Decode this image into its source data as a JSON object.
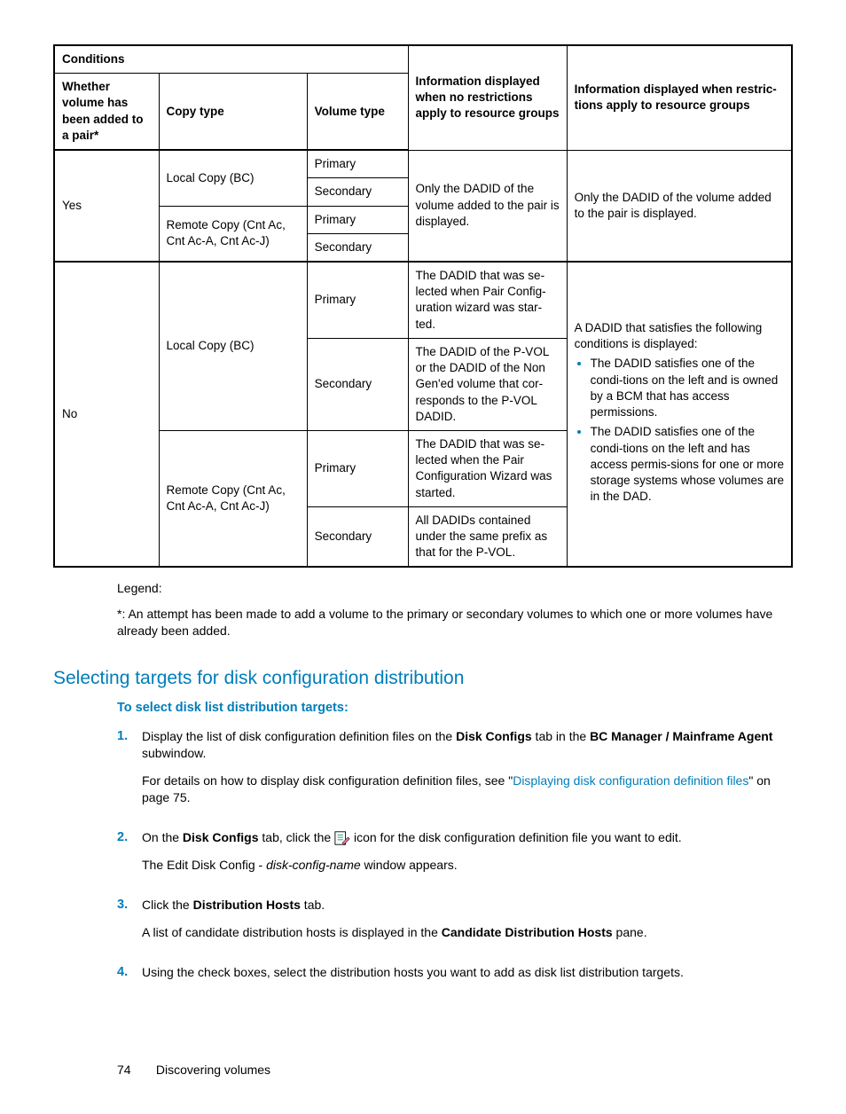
{
  "table": {
    "headers": {
      "conditions": "Conditions",
      "whether": "Whether volume has been added to a pair*",
      "copy_type": "Copy type",
      "volume_type": "Volume type",
      "info_no_restrict": "Information displayed when no restrictions apply to resource groups",
      "info_restrict": "Information displayed when restric-tions apply to resource groups"
    },
    "row_yes": {
      "whether": "Yes",
      "copy1": "Local Copy (BC)",
      "copy2": "Remote Copy (Cnt Ac, Cnt Ac-A, Cnt Ac-J)",
      "v1": "Primary",
      "v2": "Secondary",
      "v3": "Primary",
      "v4": "Secondary",
      "col4": "Only the DADID of the volume added to the pair is displayed.",
      "col5": "Only the DADID of the volume added to the pair is displayed."
    },
    "row_no": {
      "whether": "No",
      "copy1": "Local Copy (BC)",
      "copy2": "Remote Copy (Cnt Ac, Cnt Ac-A, Cnt Ac-J)",
      "v1": "Primary",
      "v2": "Secondary",
      "v3": "Primary",
      "v4": "Secondary",
      "c4_1": "The DADID that was se-lected when Pair Config-uration wizard was star-ted.",
      "c4_2": "The DADID of the P-VOL or the DADID of the Non Gen'ed volume that cor-responds to the P-VOL DADID.",
      "c4_3": "The DADID that was se-lected when the Pair Configuration Wizard was started.",
      "c4_4": "All DADIDs contained under the same prefix as that for the P-VOL.",
      "c5_intro": "A DADID that satisfies the following conditions is displayed:",
      "c5_b1": "The DADID satisfies one of the condi-tions on the left and  is owned by a BCM that has access permissions.",
      "c5_b2": "The DADID satisfies one of the condi-tions on the left and has access permis-sions for one or more storage systems whose volumes are in the DAD."
    }
  },
  "legend": {
    "title": "Legend:",
    "note": "*: An attempt has been made to add a volume to the primary or secondary volumes to which one or more volumes have already been added."
  },
  "heading": "Selecting targets for disk configuration distribution",
  "subhead": "To select disk list distribution targets:",
  "steps": {
    "s1": {
      "num": "1.",
      "p1a": "Display the list of disk configuration definition files on the ",
      "p1b": "Disk Configs",
      "p1c": " tab in the ",
      "p1d": "BC Manager / Mainframe Agent",
      "p1e": " subwindow.",
      "p2a": "For details on how to display disk configuration definition files, see \"",
      "p2link": "Displaying disk configuration definition files",
      "p2b": "\" on page 75."
    },
    "s2": {
      "num": "2.",
      "p1a": "On the ",
      "p1b": "Disk Configs",
      "p1c": " tab, click the ",
      "p1d": " icon for the disk configuration definition file you want to edit.",
      "p2a": "The Edit Disk Config - ",
      "p2i": "disk-config-name",
      "p2b": " window appears."
    },
    "s3": {
      "num": "3.",
      "p1a": "Click the ",
      "p1b": "Distribution Hosts",
      "p1c": " tab.",
      "p2a": "A list of candidate distribution hosts is displayed in the ",
      "p2b": "Candidate Distribution Hosts",
      "p2c": " pane."
    },
    "s4": {
      "num": "4.",
      "p1": "Using the check boxes, select the distribution hosts you want to add as disk list distribution targets."
    }
  },
  "footer": {
    "page": "74",
    "chapter": "Discovering volumes"
  }
}
